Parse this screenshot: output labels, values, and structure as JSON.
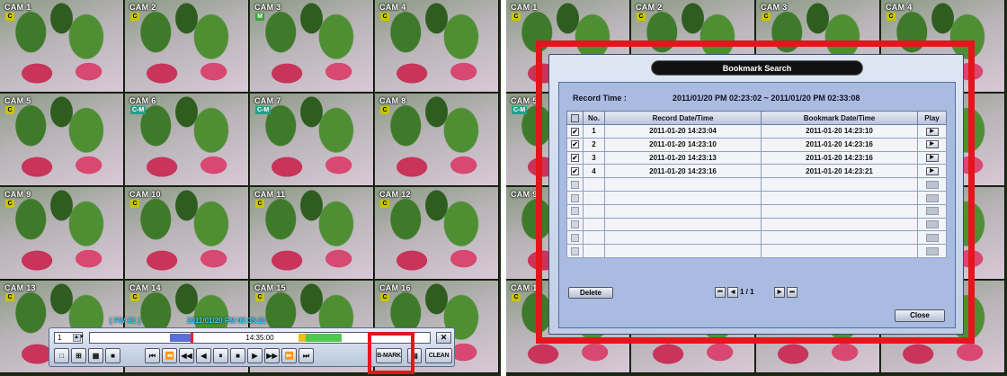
{
  "left_screen": {
    "cameras": [
      {
        "label": "CAM 1",
        "flag": "C"
      },
      {
        "label": "CAM 2",
        "flag": "C"
      },
      {
        "label": "CAM 3",
        "flag": "M"
      },
      {
        "label": "CAM 4",
        "flag": "C"
      },
      {
        "label": "CAM 5",
        "flag": "C"
      },
      {
        "label": "CAM 6",
        "flag": "C-M"
      },
      {
        "label": "CAM 7",
        "flag": "C-M"
      },
      {
        "label": "CAM 8",
        "flag": "C"
      },
      {
        "label": "CAM 9",
        "flag": "C"
      },
      {
        "label": "CAM 10",
        "flag": "C"
      },
      {
        "label": "CAM 11",
        "flag": "C"
      },
      {
        "label": "CAM 12",
        "flag": "C"
      },
      {
        "label": "CAM 13",
        "flag": "C"
      },
      {
        "label": "CAM 14",
        "flag": "C"
      },
      {
        "label": "CAM 15",
        "flag": "C"
      },
      {
        "label": "CAM 16",
        "flag": "C"
      }
    ],
    "playback": {
      "speed": "[ FW X1 ]",
      "datetime": "2011/01/20 PM 02:35:21"
    },
    "toolbar": {
      "channel": "1",
      "spin": "▲▼",
      "timeline_time": "14:35:00",
      "close": "✕",
      "layout_buttons": [
        "□",
        "⊞",
        "▦",
        "■"
      ],
      "transport_buttons": [
        "⏮",
        "⏪",
        "◀◀",
        "◀",
        "⏸",
        "■",
        "▶",
        "▶▶",
        "⏩",
        "⏭"
      ],
      "bookmark_button": "B-MARK",
      "clean_button": "CLEAN"
    }
  },
  "right_screen": {
    "cameras": [
      {
        "label": "CAM 1",
        "flag": "C"
      },
      {
        "label": "CAM 2",
        "flag": "C"
      },
      {
        "label": "CAM 3",
        "flag": "C"
      },
      {
        "label": "CAM 4",
        "flag": "C"
      },
      {
        "label": "CAM 5",
        "flag": "C-M"
      },
      {
        "label": "",
        "flag": ""
      },
      {
        "label": "",
        "flag": ""
      },
      {
        "label": "",
        "flag": ""
      },
      {
        "label": "CAM 9",
        "flag": ""
      },
      {
        "label": "",
        "flag": ""
      },
      {
        "label": "",
        "flag": ""
      },
      {
        "label": "",
        "flag": ""
      },
      {
        "label": "CAM 13",
        "flag": "C"
      },
      {
        "label": "",
        "flag": ""
      },
      {
        "label": "",
        "flag": ""
      },
      {
        "label": "",
        "flag": ""
      }
    ],
    "dialog": {
      "title": "Bookmark Search",
      "record_time_label": "Record Time :",
      "record_time_value": "2011/01/20 PM 02:23:02 ~ 2011/01/20 PM 02:33:08",
      "columns": [
        "No.",
        "Record Date/Time",
        "Bookmark Date/Time",
        "Play"
      ],
      "rows": [
        {
          "checked": true,
          "no": "1",
          "record": "2011-01-20 14:23:04",
          "bookmark": "2011-01-20 14:23:10"
        },
        {
          "checked": true,
          "no": "2",
          "record": "2011-01-20 14:23:10",
          "bookmark": "2011-01-20 14:23:16"
        },
        {
          "checked": true,
          "no": "3",
          "record": "2011-01-20 14:23:13",
          "bookmark": "2011-01-20 14:23:16"
        },
        {
          "checked": true,
          "no": "4",
          "record": "2011-01-20 14:23:16",
          "bookmark": "2011-01-20 14:23:21"
        },
        {
          "checked": false,
          "no": "",
          "record": "",
          "bookmark": ""
        },
        {
          "checked": false,
          "no": "",
          "record": "",
          "bookmark": ""
        },
        {
          "checked": false,
          "no": "",
          "record": "",
          "bookmark": ""
        },
        {
          "checked": false,
          "no": "",
          "record": "",
          "bookmark": ""
        },
        {
          "checked": false,
          "no": "",
          "record": "",
          "bookmark": ""
        },
        {
          "checked": false,
          "no": "",
          "record": "",
          "bookmark": ""
        }
      ],
      "play_glyph": "▶",
      "check_glyph": "✔",
      "delete_button": "Delete",
      "page_indicator": "1 / 1",
      "page_first": "⏮",
      "page_prev": "◀",
      "page_next": "▶",
      "page_last": "⏭",
      "close_button": "Close"
    }
  },
  "colors": {
    "highlight": "#e4151c",
    "dialog_bg": "#c0cde4",
    "title_bar": "#111111"
  }
}
